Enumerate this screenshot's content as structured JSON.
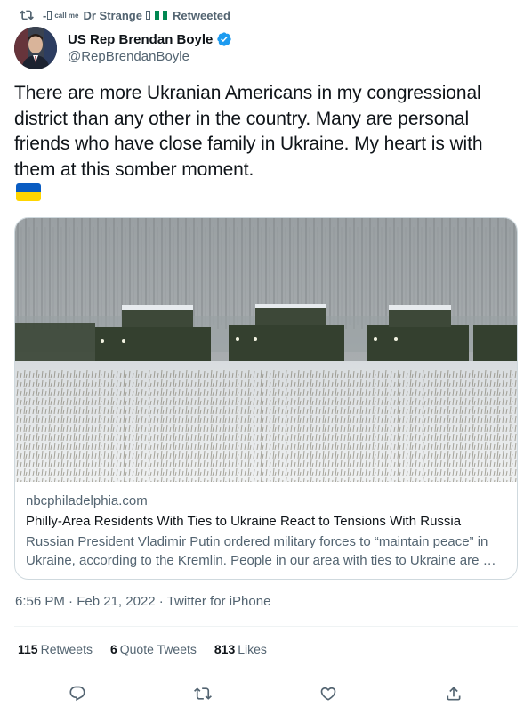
{
  "retweet_context": {
    "icon": "retweet-icon",
    "prefix": "-",
    "sup": "call me",
    "name": "Dr Strange",
    "suffix": "Retweeted"
  },
  "author": {
    "name": "US Rep Brendan Boyle",
    "handle": "@RepBrendanBoyle",
    "verified_icon": "verified-badge-icon",
    "verified_color": "#1d9bf0"
  },
  "tweet": {
    "text": "There are more Ukranian Americans in my congressional district than any other in the country. Many are personal friends who have close family  in Ukraine. My heart is with them at this somber moment.",
    "emoji": "ukraine-flag"
  },
  "card": {
    "domain": "nbcphiladelphia.com",
    "title": "Philly-Area Residents With Ties to Ukraine React to Tensions With Russia",
    "description": "Russian President Vladimir Putin ordered military forces to “maintain peace” in Ukraine, according to the Kremlin. People in our area with ties to Ukraine are …"
  },
  "meta": {
    "time": "6:56 PM",
    "sep1": " · ",
    "date": "Feb 21, 2022",
    "sep2": " · ",
    "source": "Twitter for iPhone"
  },
  "stats": {
    "retweets_count": "115",
    "retweets_label": "Retweets",
    "quotes_count": "6",
    "quotes_label": "Quote Tweets",
    "likes_count": "813",
    "likes_label": "Likes"
  },
  "actions": [
    "reply-icon",
    "retweet-icon",
    "like-icon",
    "share-icon"
  ],
  "colors": {
    "text_primary": "#0f1419",
    "text_secondary": "#536471",
    "border": "#cfd9de",
    "accent": "#1d9bf0"
  }
}
